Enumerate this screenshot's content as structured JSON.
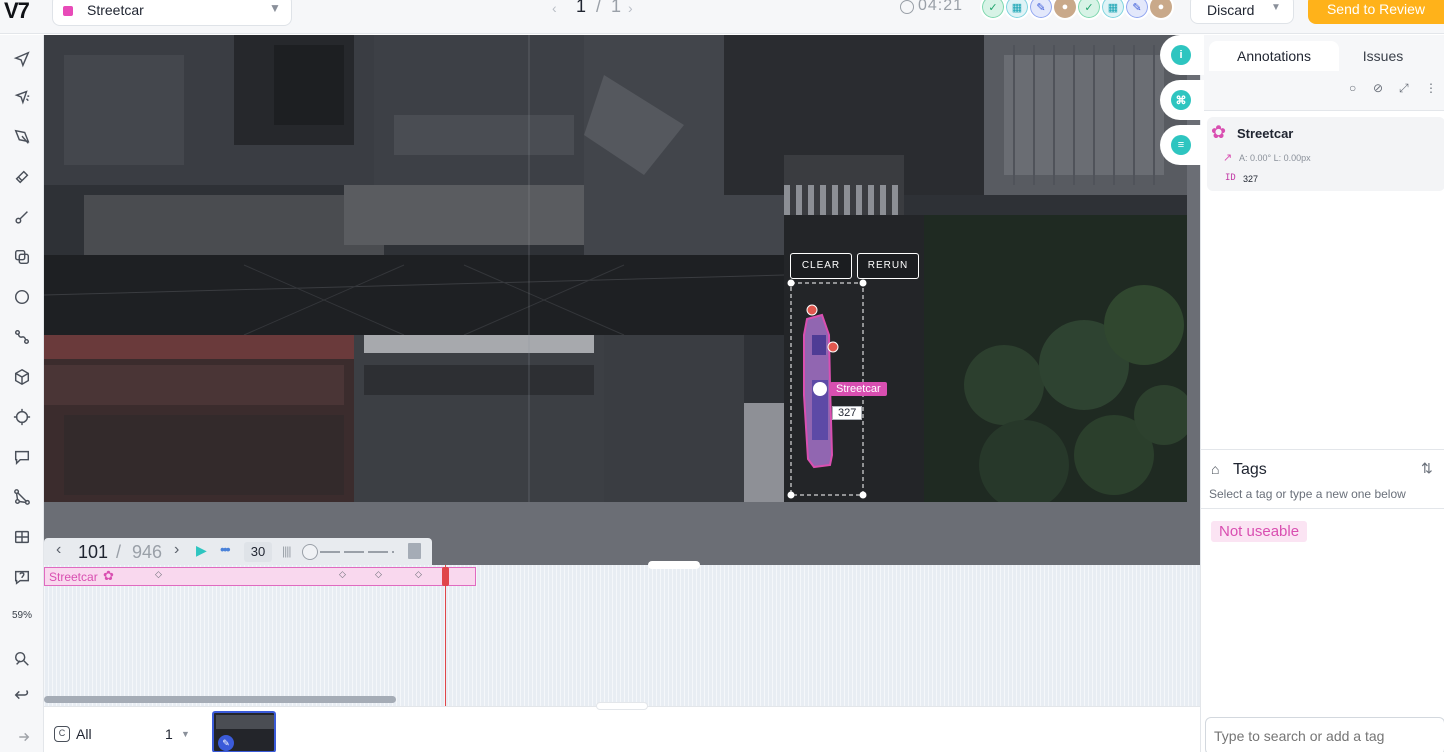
{
  "topbar": {
    "logo": "V7",
    "class_select": {
      "value": "Streetcar",
      "swatch_color": "#e84bb8"
    },
    "item_nav": {
      "current": "1",
      "separator": "/",
      "total": "1"
    },
    "timer": "04:21",
    "stages": [
      {
        "icon": "check-icon",
        "kind": "complete"
      },
      {
        "icon": "grid-icon",
        "kind": "review"
      },
      {
        "icon": "pencil-icon",
        "kind": "annotate"
      },
      {
        "icon": "user-avatar",
        "kind": "user"
      },
      {
        "icon": "check-icon",
        "kind": "complete"
      },
      {
        "icon": "grid-icon",
        "kind": "review"
      },
      {
        "icon": "pencil-icon",
        "kind": "annotate"
      },
      {
        "icon": "user-avatar",
        "kind": "user"
      }
    ],
    "discard_label": "Discard",
    "send_label": "Send to Review"
  },
  "left_toolbar": {
    "tools": [
      "pointer-icon",
      "magic-select-icon",
      "pen-polygon-icon",
      "brush-icon",
      "keypoint-icon",
      "clone-icon",
      "ellipse-icon",
      "skeleton-icon",
      "cube-icon",
      "target-icon",
      "comment-icon",
      "graph-icon",
      "table-icon",
      "question-icon"
    ],
    "zoom": "59%",
    "bottom_tools": [
      "auto-annotate-icon",
      "undo-icon",
      "redo-icon"
    ]
  },
  "canvas": {
    "clear_label": "CLEAR",
    "rerun_label": "RERUN",
    "annotation_label": "Streetcar",
    "annotation_id": "327",
    "annotation_color": "#d94fb1"
  },
  "timeline": {
    "frame_current": "101",
    "frame_separator": "/",
    "frame_total": "946",
    "fps": "30",
    "track_label": "Streetcar"
  },
  "bottom": {
    "filter_label": "All",
    "page": "1"
  },
  "right_panel": {
    "tabs": [
      "Annotations",
      "Issues"
    ],
    "annotation": {
      "name": "Streetcar",
      "meta": "A: 0.00° L: 0.00px",
      "id_label": "ID",
      "id": "327"
    },
    "tags_title": "Tags",
    "tags_hint": "Select a tag or type a new one below",
    "tag": "Not useable",
    "tag_input_placeholder": "Type to search or add a tag"
  }
}
